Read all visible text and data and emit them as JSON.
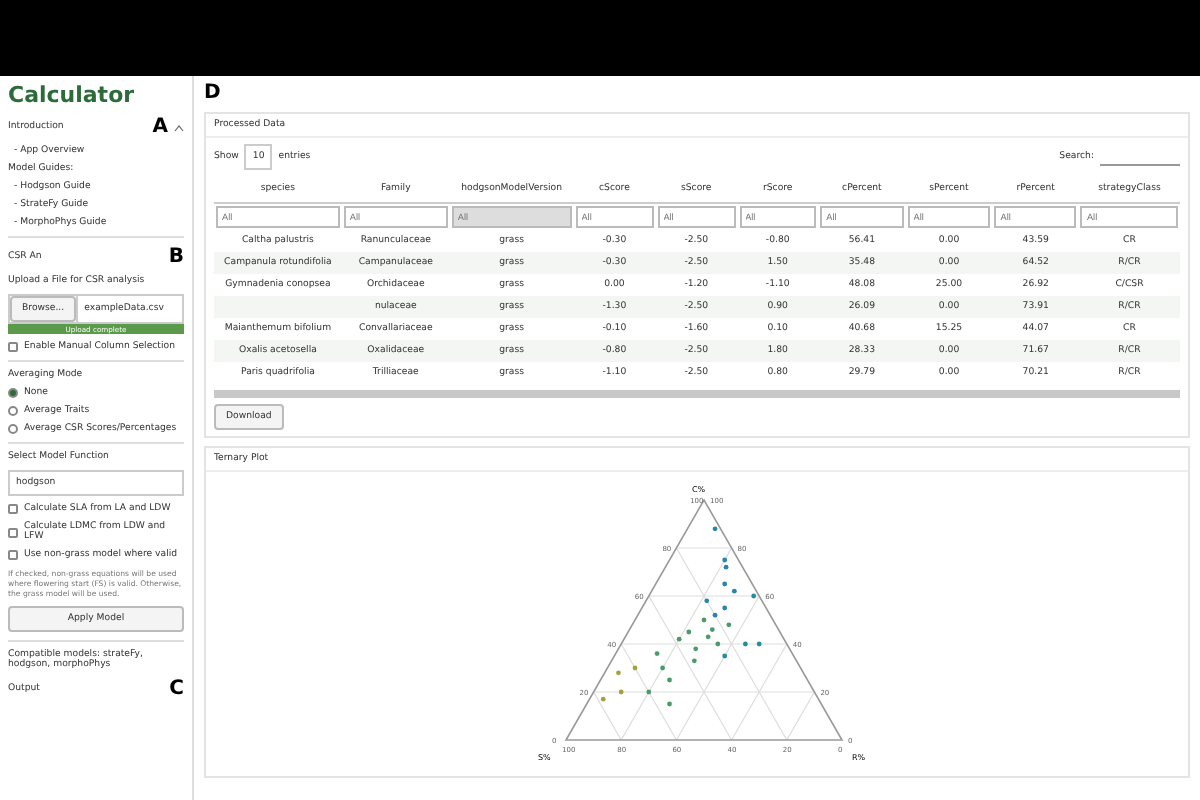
{
  "app_title": "Calculator",
  "sidebar": {
    "marker": "A",
    "section": "Introduction",
    "items": [
      {
        "label": "- App Overview",
        "kind": "link"
      },
      {
        "label": "Model Guides:",
        "kind": "heading"
      },
      {
        "label": "- Hodgson Guide",
        "kind": "link"
      },
      {
        "label": "- StrateFy Guide",
        "kind": "link"
      },
      {
        "label": "- MorphoPhys Guide",
        "kind": "link"
      }
    ],
    "csr_heading": "CSR An",
    "note_marker": "B",
    "upload_label": "Upload a File for CSR analysis",
    "browse_button": "Browse...",
    "file_name": "exampleData.csv",
    "upload_progress": {
      "status": "Upload complete",
      "level": 1
    },
    "manual_columns": {
      "label": "Enable Manual Column Selection",
      "checked": false
    },
    "averaging_label": "Averaging Mode",
    "averaging": [
      {
        "label": "None",
        "selected": true
      },
      {
        "label": "Average Traits",
        "selected": false
      },
      {
        "label": "Average CSR Scores/Percentages",
        "selected": false
      }
    ],
    "model_label": "Select Model Function",
    "model_value": "hodgson",
    "options": [
      {
        "label": "Calculate SLA from LA and LDW",
        "checked": false
      },
      {
        "label": "Calculate LDMC from LDW and LFW",
        "checked": false
      },
      {
        "label": "Use non-grass model where valid",
        "checked": false
      }
    ],
    "help": "If checked, non-grass equations will be used where flowering start (FS) is valid. Otherwise, the grass model will be used.",
    "apply_button": "Apply Model",
    "compatible": "Compatible models: strateFy, hodgson, morphoPhys",
    "output": "Output",
    "output_marker": "C"
  },
  "main": {
    "marker": "D",
    "table_panel": {
      "title": "Processed Data",
      "show": "Show",
      "page_size": "10",
      "entries": "entries",
      "search": "Search:",
      "columns": [
        "species",
        "Family",
        "hodgsonModelVersion",
        "cScore",
        "sScore",
        "rScore",
        "cPercent",
        "sPercent",
        "rPercent",
        "strategyClass"
      ],
      "filters": [
        {
          "placeholder": "All",
          "disabled": false
        },
        {
          "placeholder": "All",
          "disabled": false
        },
        {
          "placeholder": "All",
          "disabled": true
        },
        {
          "placeholder": "All",
          "disabled": false
        },
        {
          "placeholder": "All",
          "disabled": false
        },
        {
          "placeholder": "All",
          "disabled": false
        },
        {
          "placeholder": "All",
          "disabled": false
        },
        {
          "placeholder": "All",
          "disabled": false
        },
        {
          "placeholder": "All",
          "disabled": false
        },
        {
          "placeholder": "All",
          "disabled": false
        }
      ],
      "rows": [
        [
          "Caltha palustris",
          "Ranunculaceae",
          "grass",
          "-0.30",
          "-2.50",
          "-0.80",
          "56.41",
          "0.00",
          "43.59",
          "CR"
        ],
        [
          "Campanula rotundifolia",
          "Campanulaceae",
          "grass",
          "-0.30",
          "-2.50",
          "1.50",
          "35.48",
          "0.00",
          "64.52",
          "R/CR"
        ],
        [
          "Gymnadenia conopsea",
          "Orchidaceae",
          "grass",
          "0.00",
          "-1.20",
          "-1.10",
          "48.08",
          "25.00",
          "26.92",
          "C/CSR"
        ],
        [
          "",
          "nulaceae",
          "grass",
          "-1.30",
          "-2.50",
          "0.90",
          "26.09",
          "0.00",
          "73.91",
          "R/CR"
        ],
        [
          "Maianthemum bifolium",
          "Convallariaceae",
          "grass",
          "-0.10",
          "-1.60",
          "0.10",
          "40.68",
          "15.25",
          "44.07",
          "CR"
        ],
        [
          "Oxalis acetosella",
          "Oxalidaceae",
          "grass",
          "-0.80",
          "-2.50",
          "1.80",
          "28.33",
          "0.00",
          "71.67",
          "R/CR"
        ],
        [
          "Paris quadrifolia",
          "Trilliaceae",
          "grass",
          "-1.10",
          "-2.50",
          "0.80",
          "29.79",
          "0.00",
          "70.21",
          "R/CR"
        ]
      ],
      "download_button": "Download"
    },
    "plot_panel": {
      "title": "Ternary Plot",
      "axis_c": "C%",
      "axis_s": "S%",
      "axis_r": "R%",
      "ticks_c": [
        "100",
        "80",
        "60",
        "40",
        "20",
        "0"
      ],
      "ticks_s": [
        "100",
        "80",
        "60",
        "40",
        "20",
        "0"
      ],
      "ticks_r": [
        "0",
        "20",
        "40",
        "60",
        "80",
        "100"
      ]
    }
  }
}
